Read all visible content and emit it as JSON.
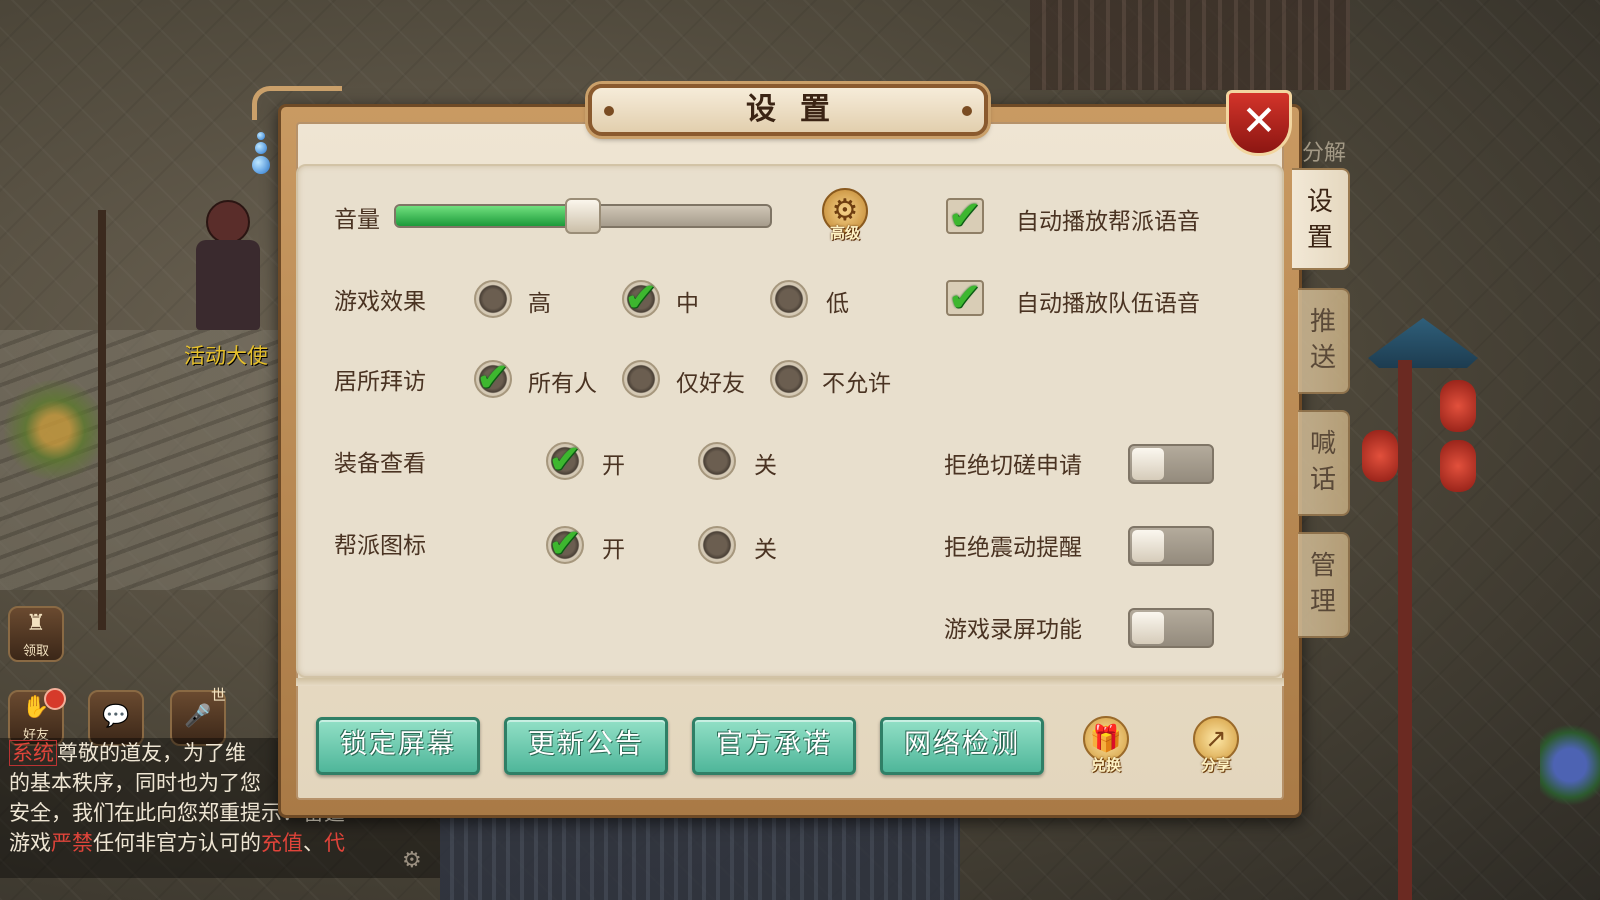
{
  "panel": {
    "title": "设置",
    "close_label": "✕",
    "side_tabs": [
      {
        "label": "设\n置",
        "active": true
      },
      {
        "label": "推\n送",
        "active": false
      },
      {
        "label": "喊\n话",
        "active": false
      },
      {
        "label": "管\n理",
        "active": false
      }
    ],
    "side_partial": "分解"
  },
  "volume": {
    "label": "音量",
    "level_percent": 50,
    "advanced_label": "高级"
  },
  "auto_voice": [
    {
      "label": "自动播放帮派语音",
      "checked": true
    },
    {
      "label": "自动播放队伍语音",
      "checked": true
    }
  ],
  "game_effect": {
    "label": "游戏效果",
    "options": [
      "高",
      "中",
      "低"
    ],
    "selected": "中"
  },
  "home_visit": {
    "label": "居所拜访",
    "options": [
      "所有人",
      "仅好友",
      "不允许"
    ],
    "selected": "所有人"
  },
  "equip_view": {
    "label": "装备查看",
    "options": [
      "开",
      "关"
    ],
    "selected": "开"
  },
  "guild_icon": {
    "label": "帮派图标",
    "options": [
      "开",
      "关"
    ],
    "selected": "开"
  },
  "toggles": [
    {
      "label": "拒绝切磋申请",
      "on": false
    },
    {
      "label": "拒绝震动提醒",
      "on": false
    },
    {
      "label": "游戏录屏功能",
      "on": false
    }
  ],
  "buttons": [
    "锁定屏幕",
    "更新公告",
    "官方承诺",
    "网络检测"
  ],
  "icon_buttons": [
    {
      "label": "兑换",
      "icon": "gift-icon"
    },
    {
      "label": "分享",
      "icon": "share-icon"
    }
  ],
  "hud": {
    "npc_name": "活动大使",
    "claim_label": "领取",
    "friend_label": "好友",
    "mic_label": "世"
  },
  "chat": {
    "tag": "系统",
    "lines": [
      "尊敬的道友，为了维",
      "的基本秩序，同时也为了您",
      "安全，我们在此向您郑重提示：雷霆",
      "游戏"
    ],
    "red_words": [
      "严禁",
      "充值",
      "代"
    ],
    "line4_mid": "任何非官方认可的",
    "line4_sep": "、"
  },
  "colors": {
    "accent_green": "#3db72f",
    "button_teal": "#4fb69a",
    "close_red": "#d3342a"
  }
}
